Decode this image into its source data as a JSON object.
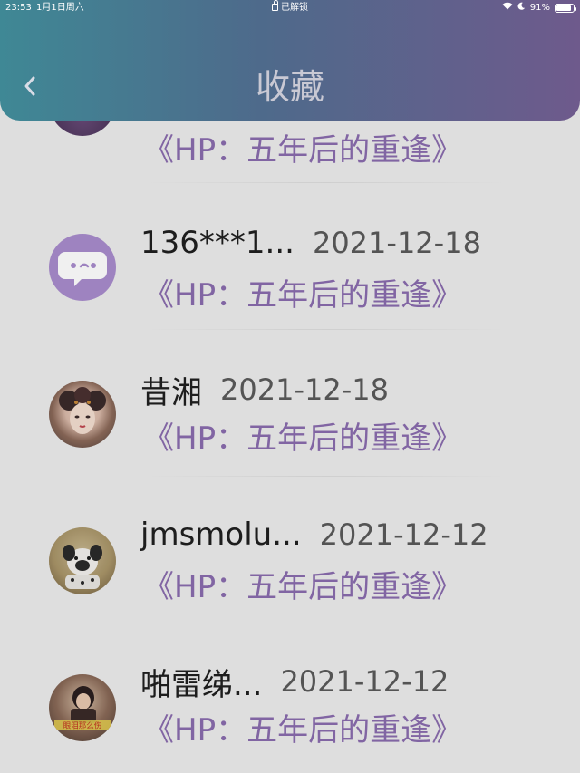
{
  "status_bar": {
    "time": "23:53",
    "date": "1月1日周六",
    "lock_text": "已解锁",
    "battery": "91%",
    "battery_level": 0.91
  },
  "header": {
    "title": "收藏",
    "back_icon": "chevron-left-icon"
  },
  "items": [
    {
      "username": "",
      "date": "",
      "book": "《HP：五年后的重逢》",
      "avatar": "purple-avatar-partial"
    },
    {
      "username": "136***1...",
      "date": "2021-12-18",
      "book": "《HP：五年后的重逢》",
      "avatar": "chat-bubble-icon"
    },
    {
      "username": "昔湘",
      "date": "2021-12-18",
      "book": "《HP：五年后的重逢》",
      "avatar": "portrait-girl"
    },
    {
      "username": "jmsmolu...",
      "date": "2021-12-12",
      "book": "《HP：五年后的重逢》",
      "avatar": "dog-photo"
    },
    {
      "username": "啪雷绨...",
      "date": "2021-12-12",
      "book": "《HP：五年后的重逢》",
      "avatar": "photo-caption",
      "avatar_caption": "眼泪那么伤"
    }
  ],
  "colors": {
    "header_start": "#3f8895",
    "header_end": "#6e5a8c",
    "book_title": "#8a6cae",
    "avatar_purple": "#a88ccc"
  }
}
